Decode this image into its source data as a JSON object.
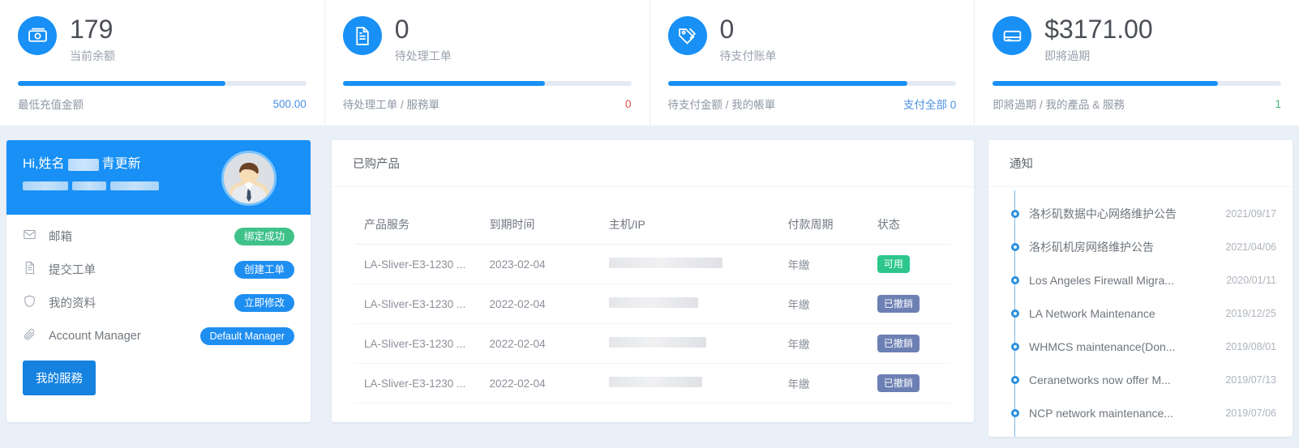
{
  "stats": [
    {
      "icon": "money-icon",
      "value": "179",
      "label": "当前余额",
      "progress": 72,
      "foot_label": "最低充值金额",
      "foot_value": "500.00",
      "foot_value_color": "blue"
    },
    {
      "icon": "document-icon",
      "value": "0",
      "label": "待处理工单",
      "progress": 70,
      "foot_label": "待处理工单 / 服務單",
      "foot_value": "0",
      "foot_value_color": "red"
    },
    {
      "icon": "tag-icon",
      "value": "0",
      "label": "待支付账单",
      "progress": 83,
      "foot_label": "待支付金额 / 我的帳單",
      "foot_value": "支付全部 0",
      "foot_value_color": "blue"
    },
    {
      "icon": "server-icon",
      "value": "$3171.00",
      "label": "即將過期",
      "progress": 78,
      "foot_label": "即將過期 / 我的產品 & 服務",
      "foot_value": "1",
      "foot_value_color": "green"
    }
  ],
  "profile": {
    "greeting_prefix": "Hi,姓名",
    "greeting_suffix": "青更新",
    "items": [
      {
        "icon": "mail-icon",
        "label": "邮箱",
        "badge": "绑定成功",
        "badge_color": "green"
      },
      {
        "icon": "document-icon",
        "label": "提交工单",
        "badge": "创建工单",
        "badge_color": "blue"
      },
      {
        "icon": "shield-icon",
        "label": "我的资料",
        "badge": "立即修改",
        "badge_color": "blue"
      },
      {
        "icon": "paperclip-icon",
        "label": "Account Manager",
        "badge": "Default Manager",
        "badge_color": "blue"
      }
    ],
    "service_button": "我的服務"
  },
  "products": {
    "title": "已购产品",
    "columns": [
      "产品服务",
      "到期时间",
      "主机/IP",
      "付款周期",
      "状态"
    ],
    "rows": [
      {
        "service": "LA-Sliver-E3-1230 ...",
        "expiry": "2023-02-04",
        "ip_width": 140,
        "cycle": "年繳",
        "status": "可用",
        "status_type": "available"
      },
      {
        "service": "LA-Sliver-E3-1230 ...",
        "expiry": "2022-02-04",
        "ip_width": 110,
        "cycle": "年繳",
        "status": "已撤銷",
        "status_type": "cancelled"
      },
      {
        "service": "LA-Sliver-E3-1230 ...",
        "expiry": "2022-02-04",
        "ip_width": 120,
        "cycle": "年繳",
        "status": "已撤銷",
        "status_type": "cancelled"
      },
      {
        "service": "LA-Sliver-E3-1230 ...",
        "expiry": "2022-02-04",
        "ip_width": 115,
        "cycle": "年繳",
        "status": "已撤銷",
        "status_type": "cancelled"
      }
    ]
  },
  "notices": {
    "title": "通知",
    "items": [
      {
        "title": "洛杉矶数据中心网络维护公告",
        "date": "2021/09/17"
      },
      {
        "title": "洛杉矶机房网络维护公告",
        "date": "2021/04/06"
      },
      {
        "title": "Los Angeles Firewall Migra...",
        "date": "2020/01/11"
      },
      {
        "title": "LA Network Maintenance",
        "date": "2019/12/25"
      },
      {
        "title": "WHMCS maintenance(Don...",
        "date": "2019/08/01"
      },
      {
        "title": "Ceranetworks now offer M...",
        "date": "2019/07/13"
      },
      {
        "title": "NCP network maintenance...",
        "date": "2019/07/06"
      }
    ]
  },
  "colors": {
    "accent": "#1890f5",
    "success": "#2dc68c",
    "cancelled": "#6d80b4",
    "page_bg": "#eaf0f8"
  }
}
